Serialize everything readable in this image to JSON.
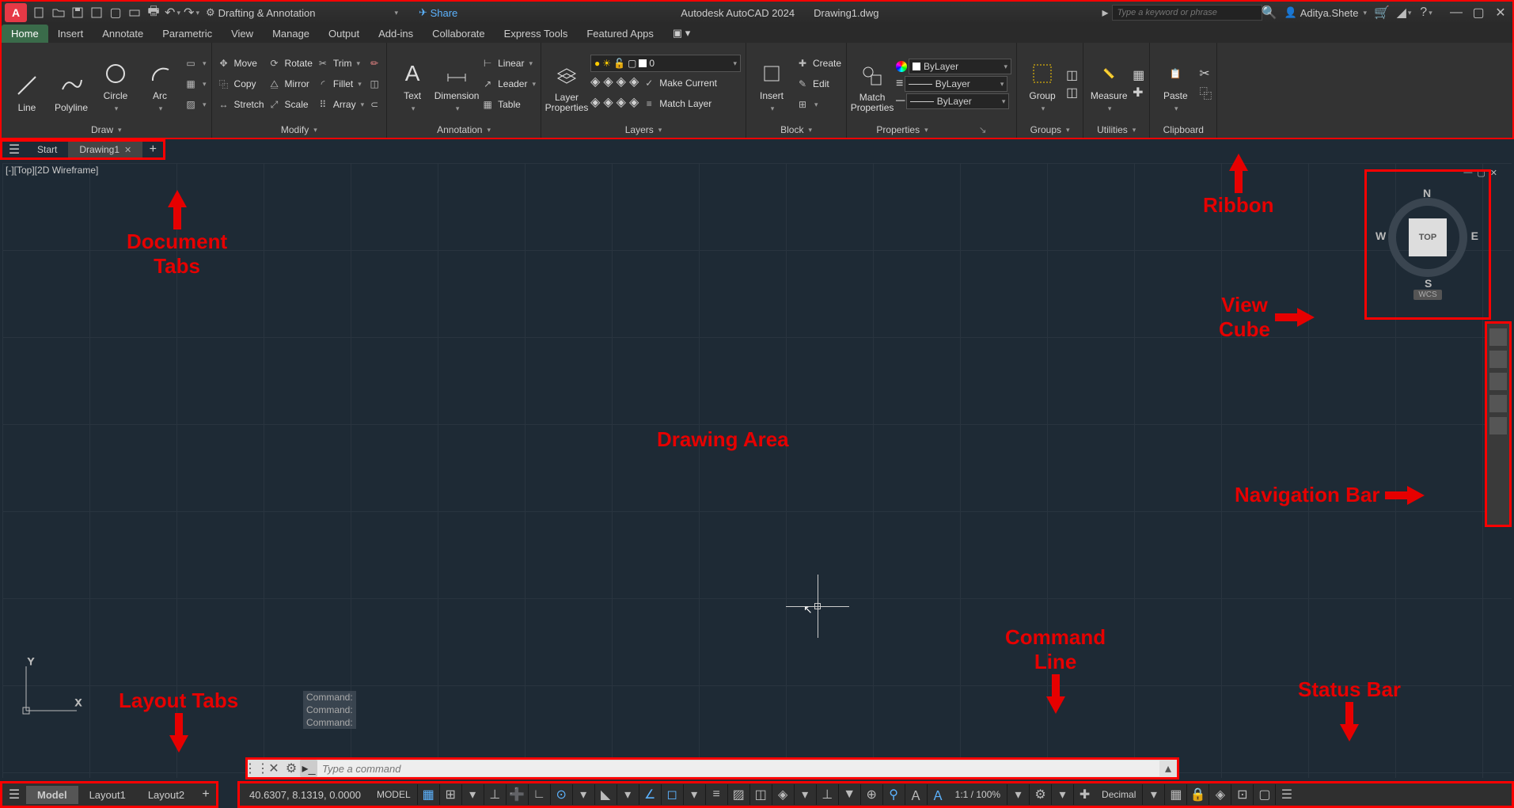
{
  "title_bar": {
    "app": "A",
    "workspace": "Drafting & Annotation",
    "share": "Share",
    "product": "Autodesk AutoCAD 2024",
    "file": "Drawing1.dwg",
    "search_placeholder": "Type a keyword or phrase",
    "user": "Aditya.Shete"
  },
  "menu_tabs": [
    "Home",
    "Insert",
    "Annotate",
    "Parametric",
    "View",
    "Manage",
    "Output",
    "Add-ins",
    "Collaborate",
    "Express Tools",
    "Featured Apps"
  ],
  "menu_active": "Home",
  "ribbon": {
    "draw": {
      "title": "Draw",
      "items": [
        "Line",
        "Polyline",
        "Circle",
        "Arc"
      ]
    },
    "modify": {
      "title": "Modify",
      "col1": [
        "Move",
        "Copy",
        "Stretch"
      ],
      "col2": [
        "Rotate",
        "Mirror",
        "Scale"
      ],
      "col3": [
        "Trim",
        "Fillet",
        "Array"
      ]
    },
    "annotation": {
      "title": "Annotation",
      "text": "Text",
      "dimension": "Dimension",
      "linear": "Linear",
      "leader": "Leader",
      "table": "Table"
    },
    "layers": {
      "title": "Layers",
      "props": "Layer\nProperties",
      "current_layer": "0",
      "make_current": "Make Current",
      "match_layer": "Match Layer"
    },
    "block": {
      "title": "Block",
      "insert": "Insert",
      "create": "Create",
      "edit": "Edit"
    },
    "properties": {
      "title": "Properties",
      "match": "Match\nProperties",
      "bylayer": "ByLayer"
    },
    "groups": {
      "title": "Groups",
      "group": "Group"
    },
    "utilities": {
      "title": "Utilities",
      "measure": "Measure"
    },
    "clipboard": {
      "title": "Clipboard",
      "paste": "Paste"
    }
  },
  "doc_tabs": {
    "start": "Start",
    "active": "Drawing1"
  },
  "viewport": {
    "label": "[-][Top][2D Wireframe]"
  },
  "viewcube": {
    "face": "TOP",
    "n": "N",
    "s": "S",
    "e": "E",
    "w": "W",
    "wcs": "WCS"
  },
  "cmd": {
    "history": [
      "Command:",
      "Command:",
      "Command:"
    ],
    "placeholder": "Type a command"
  },
  "layout_tabs": [
    "Model",
    "Layout1",
    "Layout2"
  ],
  "layout_active": "Model",
  "status": {
    "coords": "40.6307, 8.1319, 0.0000",
    "space": "MODEL",
    "scale": "1:1 / 100%",
    "units": "Decimal"
  },
  "annotations": {
    "doc_tabs": "Document\nTabs",
    "ribbon": "Ribbon",
    "drawing": "Drawing Area",
    "viewcube": "View\nCube",
    "navbar": "Navigation Bar",
    "cmd": "Command\nLine",
    "status": "Status Bar",
    "layout": "Layout Tabs"
  }
}
